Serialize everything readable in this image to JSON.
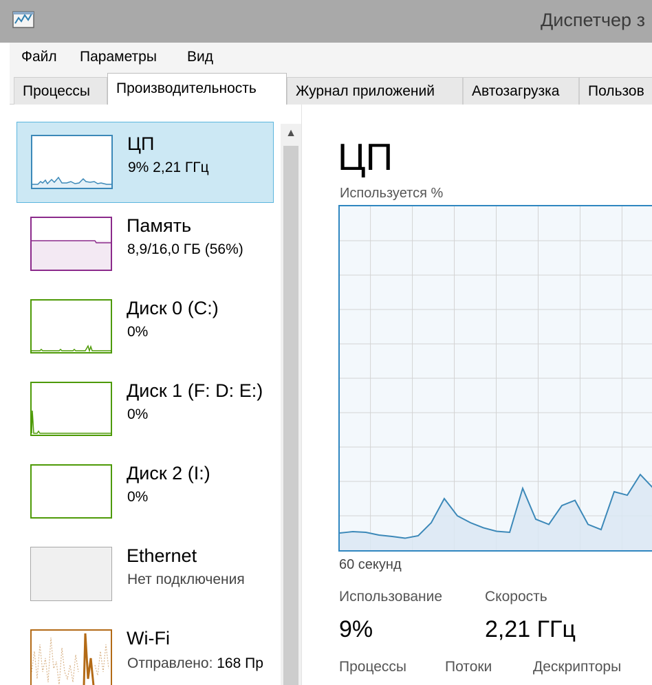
{
  "window": {
    "title": "Диспетчер з"
  },
  "menu": {
    "items": [
      "Файл",
      "Параметры",
      "Вид"
    ]
  },
  "tabs": [
    "Процессы",
    "Производительность",
    "Журнал приложений",
    "Автозагрузка",
    "Пользов"
  ],
  "sidebar": {
    "items": [
      {
        "name": "ЦП",
        "sub": "9%  2,21 ГГц"
      },
      {
        "name": "Память",
        "sub": "8,9/16,0 ГБ (56%)"
      },
      {
        "name": "Диск 0 (C:)",
        "sub": "0%"
      },
      {
        "name": "Диск 1 (F: D: E:)",
        "sub": "0%"
      },
      {
        "name": "Диск 2 (I:)",
        "sub": "0%"
      },
      {
        "name": "Ethernet",
        "sub": "Нет подключения"
      },
      {
        "name": "Wi-Fi",
        "sub_label": "Отправлено:",
        "sub_value": "168 Пр"
      }
    ]
  },
  "main": {
    "title": "ЦП",
    "chart_caption": "Используется %",
    "time_label": "60 секунд",
    "stats": {
      "usage_label": "Использование",
      "usage_value": "9%",
      "speed_label": "Скорость",
      "speed_value": "2,21 ГГц",
      "processes_label": "Процессы",
      "threads_label": "Потоки",
      "handles_label": "Дескрипторы"
    }
  },
  "colors": {
    "cpu": "#3b88b8",
    "memory": "#8b2a8b",
    "disk": "#4d9a06",
    "ethernet": "#a8a8a8",
    "wifi": "#b36a16",
    "selection": "#cce8f4"
  },
  "chart_data": {
    "type": "area",
    "ylabel": "Используется %",
    "xlabel": "60 секунд",
    "ylim": [
      0,
      100
    ],
    "grid": true,
    "series": [
      {
        "values": [
          5,
          5.4,
          5.2,
          4.4,
          4,
          3.5,
          4.2,
          8,
          15,
          10,
          8,
          6.5,
          5.5,
          5.2,
          18,
          9,
          7.5,
          13,
          14.5,
          7.5,
          6,
          17,
          16,
          22,
          18
        ]
      }
    ]
  }
}
